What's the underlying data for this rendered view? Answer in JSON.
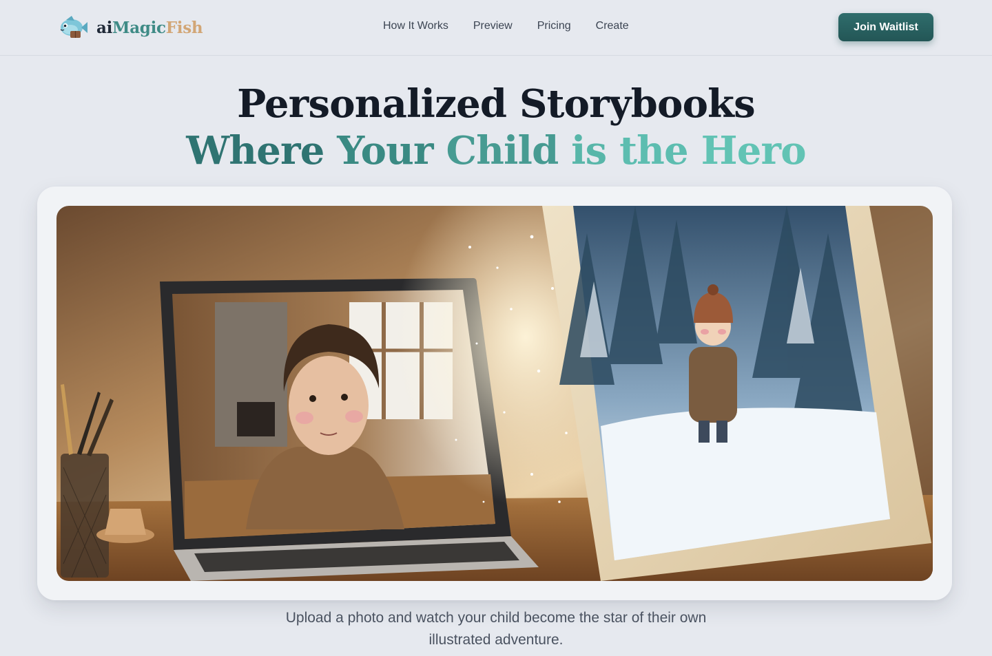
{
  "brand": {
    "part1": "ai",
    "part2": "Magic",
    "part3": "Fish",
    "logo_icon": "fish-mascot-icon",
    "colors": {
      "ai": "#1f2937",
      "magic": "#3f8b86",
      "fish": "#d2a676"
    }
  },
  "nav": {
    "items": [
      {
        "label": "How It Works"
      },
      {
        "label": "Preview"
      },
      {
        "label": "Pricing"
      },
      {
        "label": "Create"
      }
    ]
  },
  "cta": {
    "label": "Join Waitlist",
    "color": "#2a6262"
  },
  "hero": {
    "title_line1": "Personalized Storybooks",
    "title_line2_words": [
      "Where",
      "Your",
      "Child",
      "is",
      "the",
      "Hero"
    ],
    "title_line2_gradient": [
      "#2f7472",
      "#62c3b4"
    ],
    "image_alt_icon": "photo-to-storybook-illustration"
  },
  "subtitle": {
    "line1": "Upload a photo and watch your child become the star of their own",
    "line2": "illustrated adventure."
  },
  "colors": {
    "background": "#e6e9ef",
    "headline": "#141b27",
    "body_text": "#4a5260"
  }
}
